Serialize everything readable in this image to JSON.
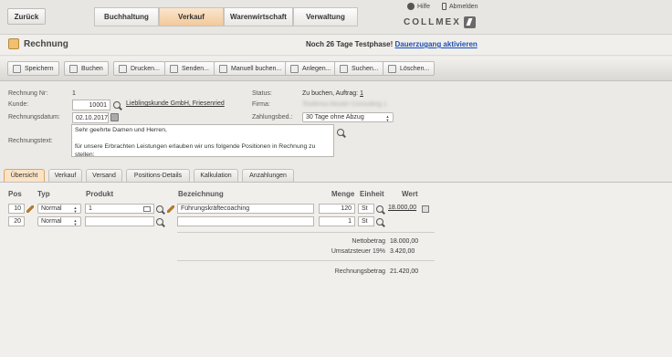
{
  "topbar": {
    "back_label": "Zurück",
    "nav_tabs": [
      "Buchhaltung",
      "Verkauf",
      "Warenwirtschaft",
      "Verwaltung"
    ],
    "active_tab": "Verkauf",
    "help_label": "Hilfe",
    "logout_label": "Abmelden",
    "logo_text": "COLLMEX"
  },
  "header": {
    "title": "Rechnung",
    "trial_text": "Noch 26 Tage Testphase!",
    "trial_link": "Dauerzugang aktivieren"
  },
  "toolbar": {
    "buttons": [
      "Speichern",
      "Buchen",
      "Drucken...",
      "Senden...",
      "Manuell buchen...",
      "Anlegen...",
      "Suchen...",
      "Löschen..."
    ]
  },
  "form": {
    "invoice_no_label": "Rechnung Nr:",
    "invoice_no": "1",
    "customer_label": "Kunde:",
    "customer_value": "10001",
    "customer_name": "Lieblingskunde GmbH, Friesenried",
    "date_label": "Rechnungsdatum:",
    "date_value": "02.10.2017",
    "text_label": "Rechnungstext:",
    "text_value": "Sehr geehrte Damen und Herren,\n\nfür unsere Erbrachten Leistungen erlauben wir uns folgende Positionen in Rechnung zu stellen:",
    "status_label": "Status:",
    "status_value": "Zu buchen, Auftrag:",
    "status_link": "1",
    "company_label": "Firma:",
    "company_value": "Testfirma Muster Consulting 1",
    "payment_label": "Zahlungsbed.:",
    "payment_value": "30 Tage ohne Abzug"
  },
  "tabs": [
    "Übersicht",
    "Verkauf",
    "Versand",
    "Positions-Details",
    "Kalkulation",
    "Anzahlungen"
  ],
  "active_subtab": "Übersicht",
  "table": {
    "headers": {
      "pos": "Pos",
      "typ": "Typ",
      "produkt": "Produkt",
      "bezeichnung": "Bezeichnung",
      "menge": "Menge",
      "einheit": "Einheit",
      "wert": "Wert"
    },
    "rows": [
      {
        "pos": "10",
        "typ": "Normal",
        "produkt": "1",
        "bezeichnung": "Führungskräftecoaching",
        "menge": "120",
        "einheit": "St",
        "wert": "18.000,00"
      },
      {
        "pos": "20",
        "typ": "Normal",
        "produkt": "",
        "bezeichnung": "",
        "menge": "1",
        "einheit": "St",
        "wert": ""
      }
    ]
  },
  "totals": {
    "net_label": "Nettobetrag",
    "net_value": "18.000,00",
    "vat_label": "Umsatzsteuer 19%",
    "vat_value": "3.420,00",
    "total_label": "Rechnungsbetrag",
    "total_value": "21.420,00"
  }
}
